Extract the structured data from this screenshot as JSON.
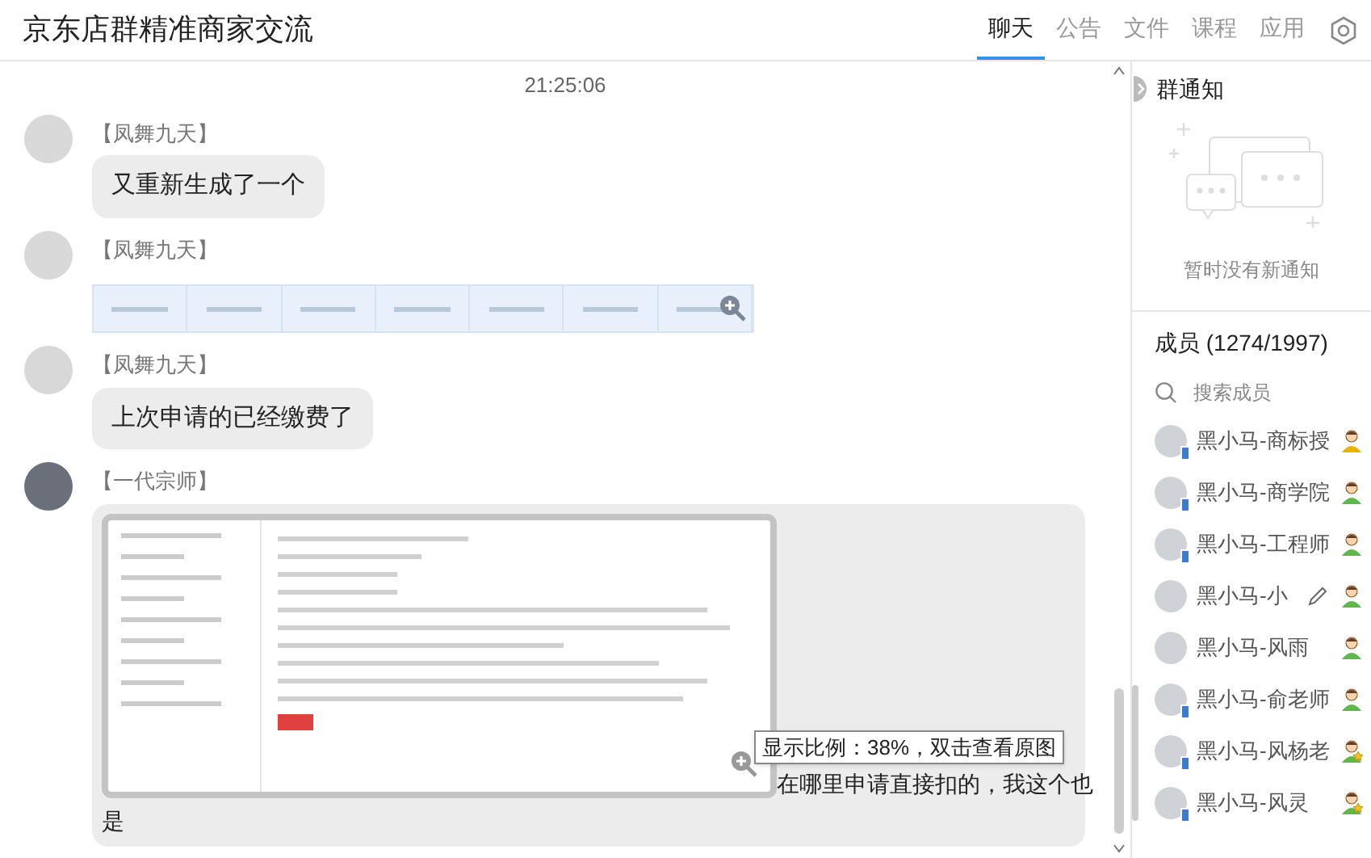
{
  "header": {
    "title": "京东店群精准商家交流",
    "tabs": [
      {
        "label": "聊天",
        "selected": true
      },
      {
        "label": "公告",
        "selected": false
      },
      {
        "label": "文件",
        "selected": false
      },
      {
        "label": "课程",
        "selected": false
      },
      {
        "label": "应用",
        "selected": false
      }
    ]
  },
  "chat": {
    "timestamp": "21:25:06",
    "messages": [
      {
        "sender": "【凤舞九天】",
        "kind": "text",
        "text": "又重新生成了一个"
      },
      {
        "sender": "【凤舞九天】",
        "kind": "image_strip"
      },
      {
        "sender": "【凤舞九天】",
        "kind": "text",
        "text": "上次申请的已经缴费了"
      },
      {
        "sender": "【一代宗师】",
        "kind": "image_text",
        "text_first": "在哪里申请直接扣的，我这个也",
        "text_rest": "是",
        "tooltip": "显示比例：38%，双击查看原图"
      }
    ]
  },
  "notice": {
    "title": "群通知",
    "empty_text": "暂时没有新通知"
  },
  "members": {
    "title": "成员 (1274/1997)",
    "search_placeholder": "搜索成员",
    "items": [
      {
        "name": "黑小马-商标授",
        "kind": "owner",
        "mobile": true,
        "hovered": false
      },
      {
        "name": "黑小马-商学院",
        "kind": "member",
        "mobile": true,
        "hovered": false
      },
      {
        "name": "黑小马-工程师",
        "kind": "member",
        "mobile": true,
        "hovered": false
      },
      {
        "name": "黑小马-小",
        "kind": "member",
        "mobile": false,
        "hovered": true
      },
      {
        "name": "黑小马-风雨",
        "kind": "member",
        "mobile": false,
        "hovered": false
      },
      {
        "name": "黑小马-俞老师",
        "kind": "member",
        "mobile": true,
        "hovered": false
      },
      {
        "name": "黑小马-风杨老",
        "kind": "admin",
        "mobile": true,
        "hovered": false
      },
      {
        "name": "黑小马-风灵",
        "kind": "admin",
        "mobile": true,
        "hovered": false
      }
    ]
  }
}
